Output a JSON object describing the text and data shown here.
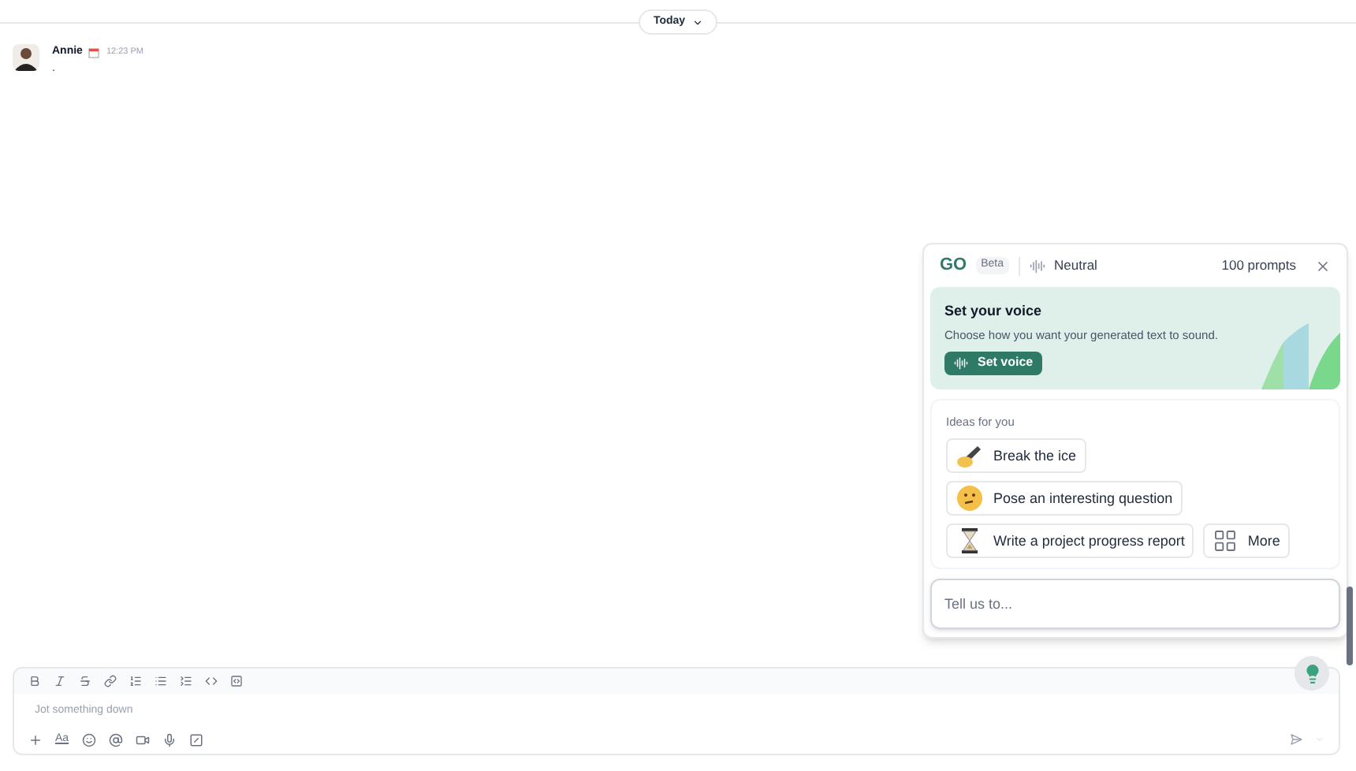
{
  "date_divider": {
    "label": "Today"
  },
  "message": {
    "author": "Annie",
    "time": "12:23 PM",
    "text": "."
  },
  "assistant_panel": {
    "logo": "GO",
    "badge": "Beta",
    "voice": "Neutral",
    "prompts": "100 prompts",
    "voice_card": {
      "title": "Set your voice",
      "text": "Choose how you want your generated text to sound.",
      "button": "Set voice"
    },
    "ideas_heading": "Ideas for you",
    "ideas": [
      {
        "kind": "write",
        "label": "Break the ice"
      },
      {
        "kind": "think",
        "label": "Pose an interesting question"
      },
      {
        "kind": "hourglass",
        "label": "Write a project progress report"
      },
      {
        "kind": "more",
        "label": "More"
      }
    ],
    "input": {
      "placeholder": "Tell us to..."
    }
  },
  "composer": {
    "placeholder": "Jot something down",
    "format_label": "Aa"
  }
}
